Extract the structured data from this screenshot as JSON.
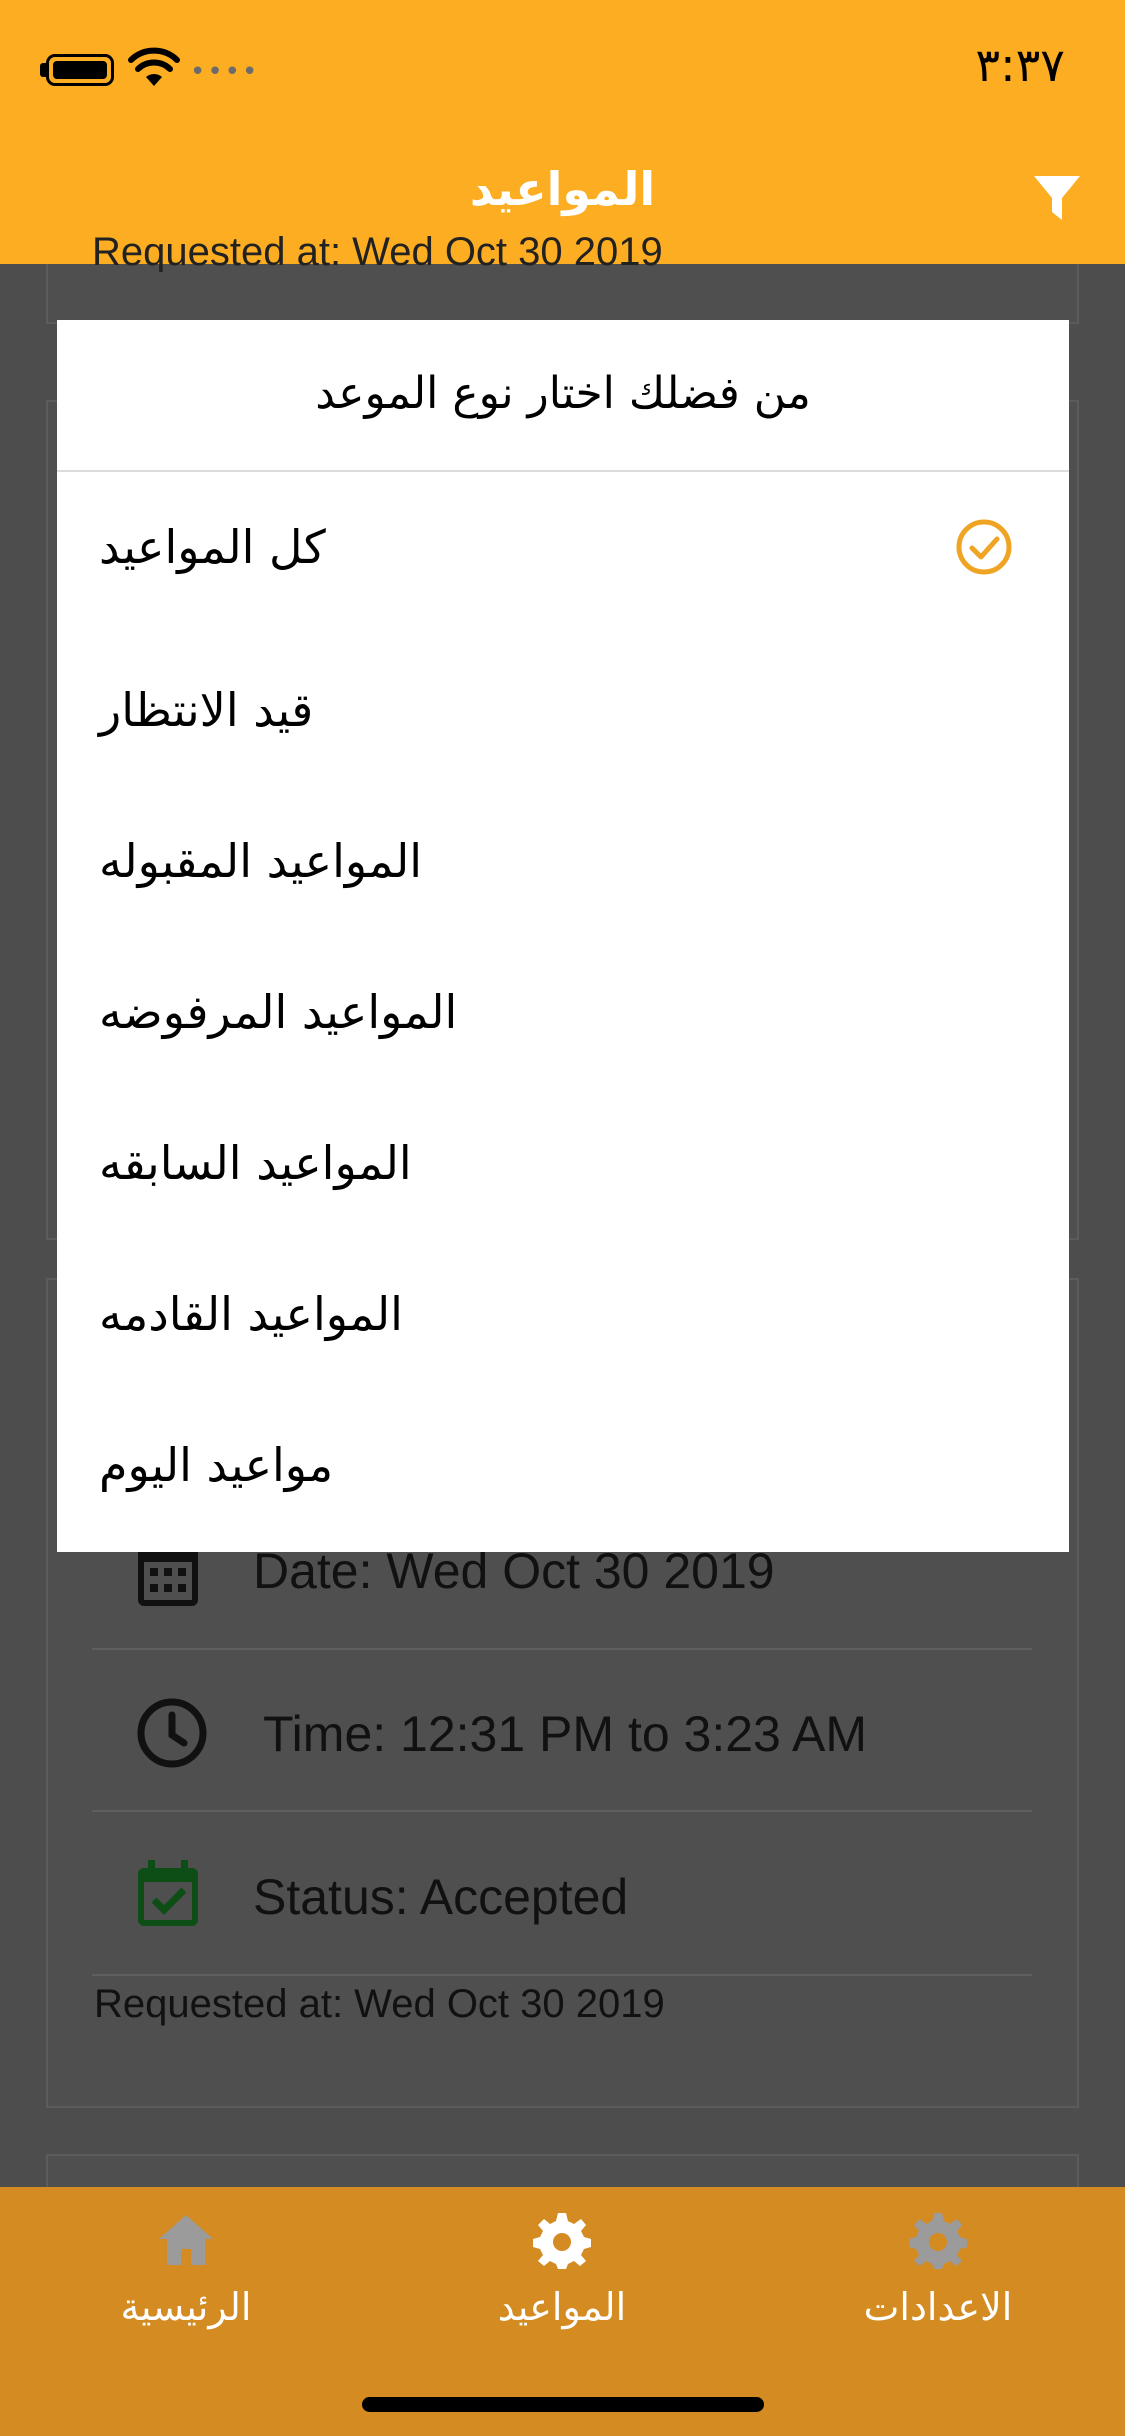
{
  "status_bar": {
    "time": "٣:٣٧",
    "signal_dots": "••••"
  },
  "nav": {
    "title": "المواعيد",
    "filter_icon": "filter-icon"
  },
  "background": {
    "peek_requested": "Requested at: Wed Oct 30 2019",
    "card": {
      "date": "Date: Wed Oct 30 2019",
      "time": "Time: 12:31 PM to 3:23 AM",
      "status": "Status: Accepted",
      "requested": "Requested at: Wed Oct 30 2019"
    }
  },
  "modal": {
    "title": "من فضلك اختار نوع الموعد",
    "options": [
      {
        "label": "كل المواعيد",
        "selected": true
      },
      {
        "label": "قيد الانتظار",
        "selected": false
      },
      {
        "label": "المواعيد المقبوله",
        "selected": false
      },
      {
        "label": "المواعيد المرفوضه",
        "selected": false
      },
      {
        "label": "المواعيد السابقه",
        "selected": false
      },
      {
        "label": "المواعيد القادمه",
        "selected": false
      },
      {
        "label": "مواعيد اليوم",
        "selected": false
      }
    ]
  },
  "tab_bar": {
    "tabs": [
      {
        "label": "الرئيسية",
        "icon": "home-icon"
      },
      {
        "label": "المواعيد",
        "icon": "gear-icon",
        "active": true
      },
      {
        "label": "الاعدادات",
        "icon": "gear-icon"
      }
    ]
  },
  "colors": {
    "accent": "#fcad22",
    "tab_bar": "#d38b22",
    "check": "#f0a424",
    "overlay": "#4d4d4d"
  }
}
